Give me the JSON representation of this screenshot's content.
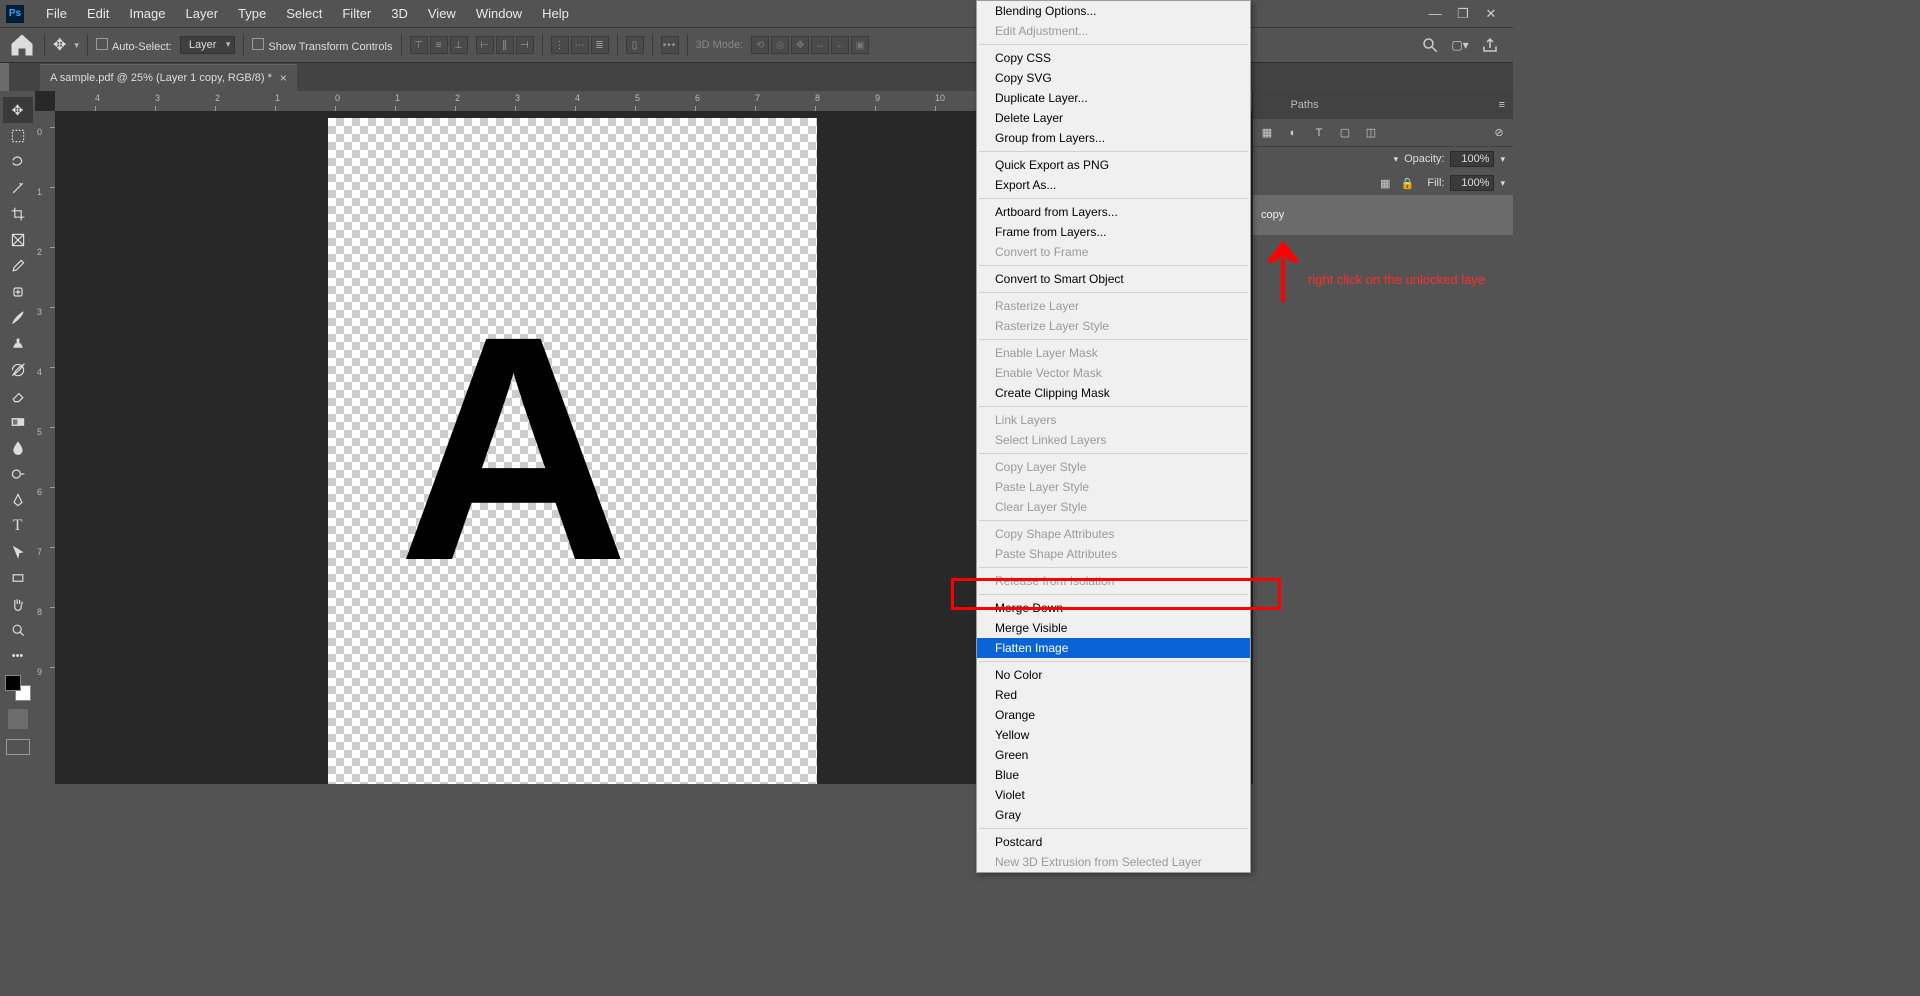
{
  "menubar": {
    "items": [
      "File",
      "Edit",
      "Image",
      "Layer",
      "Type",
      "Select",
      "Filter",
      "3D",
      "View",
      "Window",
      "Help"
    ]
  },
  "optionsBar": {
    "autoSelectLabel": "Auto-Select:",
    "autoSelectValue": "Layer",
    "transformLabel": "Show Transform Controls",
    "mode3d": "3D Mode:"
  },
  "docTab": {
    "title": "A sample.pdf @ 25% (Layer 1 copy, RGB/8) *"
  },
  "rulerH": [
    "4",
    "3",
    "2",
    "1",
    "0",
    "1",
    "2",
    "3",
    "4",
    "5",
    "6",
    "7",
    "8",
    "9",
    "10"
  ],
  "rulerV": [
    "0",
    "1",
    "2",
    "3",
    "4",
    "5",
    "6",
    "7",
    "8",
    "9"
  ],
  "canvas": {
    "letter": "A"
  },
  "rightPanel": {
    "tabPaths": "Paths",
    "opacityLabel": "Opacity:",
    "opacityValue": "100%",
    "fillLabel": "Fill:",
    "fillValue": "100%",
    "layerName": "copy"
  },
  "contextMenu": {
    "groups": [
      [
        {
          "label": "Blending Options..."
        },
        {
          "label": "Edit Adjustment...",
          "disabled": true
        }
      ],
      [
        {
          "label": "Copy CSS"
        },
        {
          "label": "Copy SVG"
        },
        {
          "label": "Duplicate Layer..."
        },
        {
          "label": "Delete Layer"
        },
        {
          "label": "Group from Layers..."
        }
      ],
      [
        {
          "label": "Quick Export as PNG"
        },
        {
          "label": "Export As..."
        }
      ],
      [
        {
          "label": "Artboard from Layers..."
        },
        {
          "label": "Frame from Layers..."
        },
        {
          "label": "Convert to Frame",
          "disabled": true
        }
      ],
      [
        {
          "label": "Convert to Smart Object"
        }
      ],
      [
        {
          "label": "Rasterize Layer",
          "disabled": true
        },
        {
          "label": "Rasterize Layer Style",
          "disabled": true
        }
      ],
      [
        {
          "label": "Enable Layer Mask",
          "disabled": true
        },
        {
          "label": "Enable Vector Mask",
          "disabled": true
        },
        {
          "label": "Create Clipping Mask"
        }
      ],
      [
        {
          "label": "Link Layers",
          "disabled": true
        },
        {
          "label": "Select Linked Layers",
          "disabled": true
        }
      ],
      [
        {
          "label": "Copy Layer Style",
          "disabled": true
        },
        {
          "label": "Paste Layer Style",
          "disabled": true
        },
        {
          "label": "Clear Layer Style",
          "disabled": true
        }
      ],
      [
        {
          "label": "Copy Shape Attributes",
          "disabled": true
        },
        {
          "label": "Paste Shape Attributes",
          "disabled": true
        }
      ],
      [
        {
          "label": "Release from Isolation",
          "disabled": true
        }
      ],
      [
        {
          "label": "Merge Down"
        },
        {
          "label": "Merge Visible"
        },
        {
          "label": "Flatten Image",
          "highlight": true
        }
      ],
      [
        {
          "label": "No Color"
        },
        {
          "label": "Red"
        },
        {
          "label": "Orange"
        },
        {
          "label": "Yellow"
        },
        {
          "label": "Green"
        },
        {
          "label": "Blue"
        },
        {
          "label": "Violet"
        },
        {
          "label": "Gray"
        }
      ],
      [
        {
          "label": "Postcard"
        },
        {
          "label": "New 3D Extrusion from Selected Layer",
          "disabled": true
        }
      ]
    ]
  },
  "annotation": {
    "text": "right click on the unlocked laye"
  },
  "psLabel": "Ps"
}
